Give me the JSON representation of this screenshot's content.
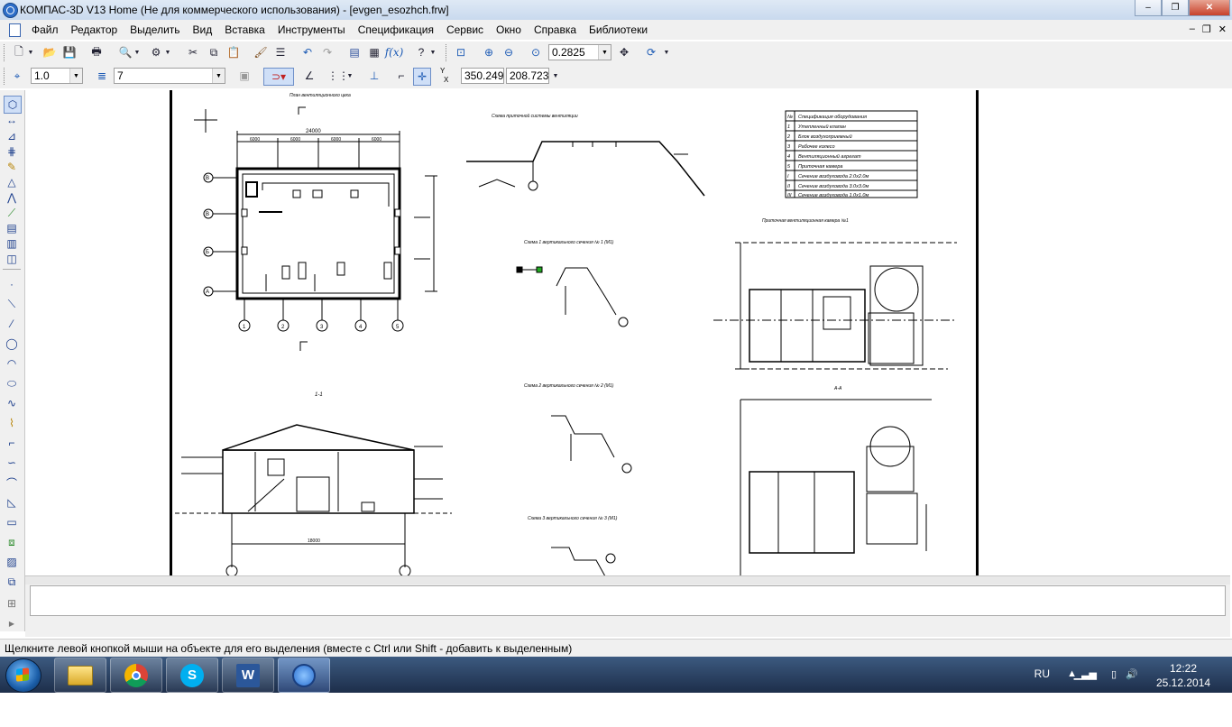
{
  "window": {
    "title": "КОМПАС-3D V13 Home (Не для коммерческого использования) - [evgen_esozhch.frw]",
    "buttons": {
      "minimize": "‒",
      "maximize": "❐",
      "close": "✕"
    }
  },
  "menu": {
    "items": [
      "Файл",
      "Редактор",
      "Выделить",
      "Вид",
      "Вставка",
      "Инструменты",
      "Спецификация",
      "Сервис",
      "Окно",
      "Справка",
      "Библиотеки"
    ],
    "mdi_buttons": [
      "–",
      "❐",
      "✕"
    ]
  },
  "toolbar1": {
    "zoom_value": "0.2825"
  },
  "toolbar2": {
    "line_scale": "1.0",
    "layer": "7",
    "coord_y_label": "Y",
    "coord_x_label": "X",
    "coord_x": "350.249",
    "coord_y": "208.723"
  },
  "command_panel": {
    "value": ""
  },
  "status": {
    "message": "Щелкните левой кнопкой мыши на объекте для его выделения (вместе с Ctrl или Shift - добавить к выделенным)"
  },
  "taskbar": {
    "apps": [
      {
        "icon": "explorer-icon"
      },
      {
        "icon": "chrome-icon"
      },
      {
        "icon": "skype-icon"
      },
      {
        "icon": "word-icon"
      },
      {
        "icon": "kompas-icon"
      }
    ],
    "language": "RU",
    "time": "12:22",
    "date": "25.12.2014"
  },
  "drawing": {
    "title_plan": "План вентиляционного цеха",
    "title_scheme": "Схема приточной системы вентиляции",
    "title_spec": "Спецификация оборудования",
    "title_node1": "Схема 1 вертикального сечения № 1 (M1)",
    "title_node2": "Схема 2 вертикального сечения № 2 (M1)",
    "title_node3": "Схема 3 вертикального сечения № 3 (M1)",
    "title_section": "1-1",
    "title_unit": "Приточная вентиляционная камера №1",
    "label_aa": "А-А",
    "dim_total_width": "24000",
    "dim_span": "6000",
    "dim_section_width": "18000",
    "axes_vertical": [
      "В",
      "В",
      "Б",
      "А"
    ],
    "axes_horizontal": [
      "1",
      "2",
      "3",
      "4",
      "5"
    ],
    "spec_rows": [
      {
        "num": "№",
        "name": "Спецификация оборудования"
      },
      {
        "num": "1",
        "name": "Утепленный клапан"
      },
      {
        "num": "2",
        "name": "Блок воздухоприемный"
      },
      {
        "num": "3",
        "name": "Рабочее колесо"
      },
      {
        "num": "4",
        "name": "Вентиляционный агрегат"
      },
      {
        "num": "5",
        "name": "Приточная камера"
      },
      {
        "num": "I",
        "name": "Сечение воздуховода 2.0х2.0м"
      },
      {
        "num": "II",
        "name": "Сечение воздуховода 3.0х3.0м"
      },
      {
        "num": "III",
        "name": "Сечение воздуховода 1.0х1.0м"
      }
    ]
  }
}
